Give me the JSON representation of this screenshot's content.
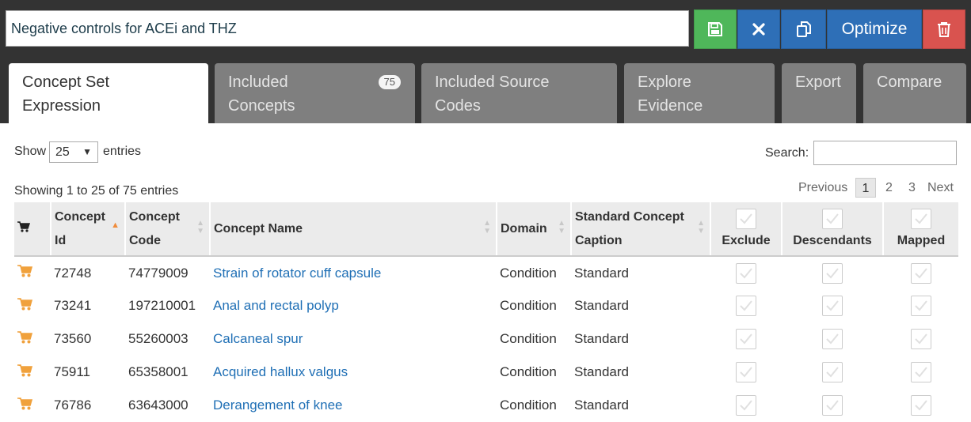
{
  "concept_set_name": "Negative controls for ACEi and THZ",
  "toolbar": {
    "save_icon": "floppy-disk-icon",
    "close_icon": "x-icon",
    "copy_icon": "copy-icon",
    "optimize_label": "Optimize",
    "delete_icon": "trash-icon"
  },
  "tabs": [
    {
      "line1": "Concept Set",
      "line2": "Expression",
      "active": true
    },
    {
      "line1": "Included",
      "line2": "Concepts",
      "badge": "75"
    },
    {
      "line1": "Included Source",
      "line2": "Codes"
    },
    {
      "line1": "Explore",
      "line2": "Evidence"
    },
    {
      "line1": "Export",
      "line2": ""
    },
    {
      "line1": "Compare",
      "line2": ""
    }
  ],
  "table_controls": {
    "show_label": "Show",
    "page_length": "25",
    "entries_label": "entries",
    "search_label": "Search:",
    "info": "Showing 1 to 25 of 75 entries"
  },
  "pagination": {
    "previous": "Previous",
    "pages": [
      "1",
      "2",
      "3"
    ],
    "current": "1",
    "next": "Next"
  },
  "columns": {
    "cart_icon": "shopping-cart-icon",
    "concept_id": [
      "Concept",
      "Id"
    ],
    "concept_code": [
      "Concept",
      "Code"
    ],
    "concept_name": "Concept Name",
    "domain": "Domain",
    "standard_caption": [
      "Standard Concept",
      "Caption"
    ],
    "exclude": "Exclude",
    "descendants": "Descendants",
    "mapped": "Mapped"
  },
  "rows": [
    {
      "id": "72748",
      "code": "74779009",
      "name": "Strain of rotator cuff capsule",
      "domain": "Condition",
      "standard": "Standard",
      "exclude": false,
      "descendants": false,
      "mapped": false
    },
    {
      "id": "73241",
      "code": "197210001",
      "name": "Anal and rectal polyp",
      "domain": "Condition",
      "standard": "Standard",
      "exclude": false,
      "descendants": false,
      "mapped": false
    },
    {
      "id": "73560",
      "code": "55260003",
      "name": "Calcaneal spur",
      "domain": "Condition",
      "standard": "Standard",
      "exclude": false,
      "descendants": false,
      "mapped": false
    },
    {
      "id": "75911",
      "code": "65358001",
      "name": "Acquired hallux valgus",
      "domain": "Condition",
      "standard": "Standard",
      "exclude": false,
      "descendants": false,
      "mapped": false
    },
    {
      "id": "76786",
      "code": "63643000",
      "name": "Derangement of knee",
      "domain": "Condition",
      "standard": "Standard",
      "exclude": false,
      "descendants": false,
      "mapped": false
    }
  ],
  "colors": {
    "topbar": "#333333",
    "save_green": "#4fb75a",
    "action_blue": "#2e6fb7",
    "delete_red": "#d9534f",
    "link_blue": "#1f6fb5",
    "cart_orange": "#f0a13c"
  }
}
